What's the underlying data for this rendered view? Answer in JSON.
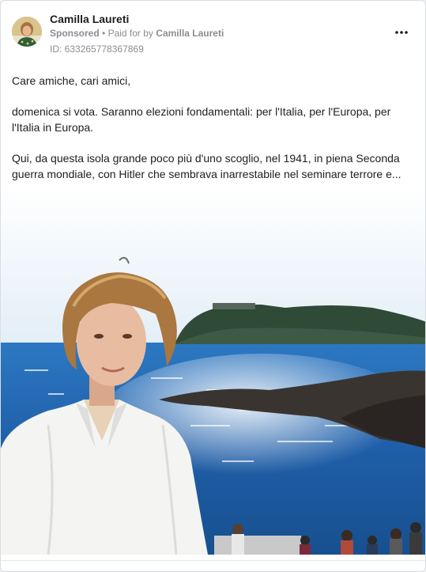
{
  "post": {
    "advertiser": "Camilla Laureti",
    "sponsored_label": "Sponsored",
    "separator": "•",
    "paid_for_prefix": "Paid for by",
    "paid_for_name": "Camilla Laureti",
    "ad_id": "ID: 633265778367869",
    "more_icon": "more-horizontal-icon",
    "body": {
      "greeting": "Care amiche, cari amici,",
      "paragraph_1": "domenica si vota. Saranno elezioni fondamentali: per l'Italia, per l'Europa, per l'Italia in Europa.",
      "paragraph_2": "Qui, da questa isola grande poco più d'uno scoglio, nel 1941, in piena Seconda guerra mondiale, con Hitler che sembrava inarrestabile nel seminare terrore e..."
    }
  },
  "colors": {
    "card_bg": "#ffffff",
    "text_primary": "#1c1e21",
    "text_secondary": "#8a8d91",
    "sea": "#1e5ea8",
    "sky": "#e8f1f8"
  }
}
